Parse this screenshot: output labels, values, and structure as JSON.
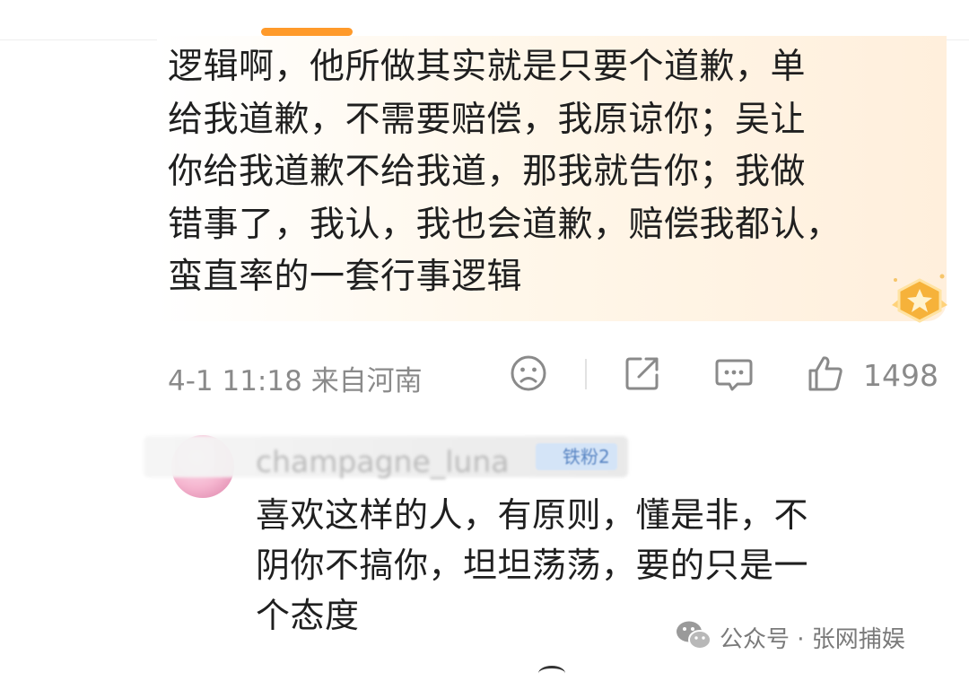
{
  "header": {
    "tab_indicator_color": "#ff9a2a"
  },
  "comment": {
    "lines": [
      "逻辑啊，他所做其实就是只要个道歉，单",
      "给我道歉，不需要赔偿，我原谅你；吴让",
      "你给我道歉不给我道，那我就告你；我做",
      "错事了，我认，我也会道歉，赔偿我都认，",
      "蛮直率的一套行事逻辑"
    ],
    "time": "4-1 11:18",
    "location": "来自河南",
    "like_count": "1498",
    "icons": [
      "sad-face-icon",
      "share-icon",
      "comment-icon",
      "thumbs-up-icon"
    ],
    "badge_icon": "gold-star-badge-icon"
  },
  "reply": {
    "username": "champagne_luna",
    "fan_badge": "铁粉2",
    "lines": [
      "喜欢这样的人，有原则，懂是非，不",
      "阴你不搞你，坦坦荡荡，要的只是一",
      "个态度"
    ]
  },
  "watermark": {
    "text": "公众号 · 张网捕娱",
    "icon": "wechat-icon"
  },
  "colors": {
    "accent": "#ff9a2a",
    "meta_gray": "#8a8a8a",
    "text": "#1f1f1f"
  }
}
